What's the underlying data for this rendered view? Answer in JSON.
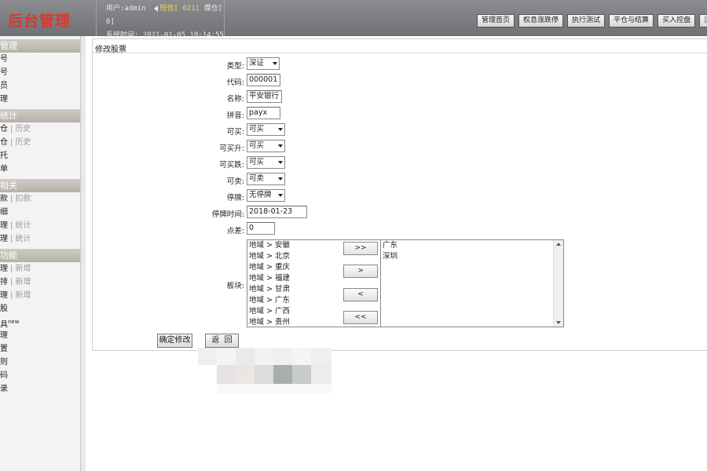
{
  "header": {
    "logo_text": "后台管理",
    "user_line": "用户:admin",
    "msg_label": "短信[ 621]",
    "extra_label": "爆仓[",
    "extra_value": "0]",
    "time_line": "系统时间: 2021-01-05 18:14:55",
    "nav_buttons": [
      "管理首页",
      "权息涨跌停",
      "执行测试",
      "平仓与结算",
      "买入控盘",
      "注"
    ]
  },
  "sidebar": {
    "sections": [
      {
        "title": "管理",
        "items": [
          {
            "label": "号"
          },
          {
            "label": "号"
          },
          {
            "label": "员"
          },
          {
            "label": "理"
          }
        ]
      },
      {
        "title": "统计",
        "items": [
          {
            "label": "仓",
            "sub": "历史"
          },
          {
            "label": "仓",
            "sub": "历史"
          },
          {
            "label": "托"
          },
          {
            "label": "单"
          }
        ]
      },
      {
        "title": "相关",
        "items": [
          {
            "label": "款",
            "sub": "扣款"
          },
          {
            "label": "细"
          },
          {
            "label": "理",
            "sub": "统计"
          },
          {
            "label": "理",
            "sub": "统计"
          }
        ]
      },
      {
        "title": "功能",
        "items": [
          {
            "label": "理",
            "sub": "新增"
          },
          {
            "label": "排",
            "sub": "新增"
          },
          {
            "label": "理",
            "sub": "新增"
          },
          {
            "label": "股"
          },
          {
            "label": "具",
            "sup": "new"
          },
          {
            "label": "理"
          },
          {
            "label": "置"
          },
          {
            "label": "则"
          },
          {
            "label": "码"
          },
          {
            "label": "录"
          }
        ]
      }
    ]
  },
  "form": {
    "title": "修改股票",
    "fields": {
      "type": {
        "label": "类型:",
        "value": "深证"
      },
      "code": {
        "label": "代码:",
        "value": "000001"
      },
      "name": {
        "label": "名称:",
        "value": "平安银行"
      },
      "pinyin": {
        "label": "拼音:",
        "value": "payx"
      },
      "can_buy": {
        "label": "可买:",
        "value": "可买"
      },
      "can_buy_up": {
        "label": "可买升:",
        "value": "可买"
      },
      "can_buy_down": {
        "label": "可买跌:",
        "value": "可买"
      },
      "can_sell": {
        "label": "可卖:",
        "value": "可卖"
      },
      "suspend": {
        "label": "停牌:",
        "value": "无停牌"
      },
      "suspend_time": {
        "label": "停牌时间:",
        "value": "2018-01-23"
      },
      "spread": {
        "label": "点差:",
        "value": "0"
      }
    },
    "sector": {
      "label": "板块:",
      "available": [
        "地域 > 安徽",
        "地域 > 北京",
        "地域 > 重庆",
        "地域 > 福建",
        "地域 > 甘肃",
        "地域 > 广东",
        "地域 > 广西",
        "地域 > 贵州"
      ],
      "selected": [
        "广东",
        "深圳"
      ],
      "move_buttons": [
        ">>",
        ">",
        "<",
        "<<"
      ]
    },
    "submit_label": "确定修改",
    "back_label": "返  回"
  }
}
